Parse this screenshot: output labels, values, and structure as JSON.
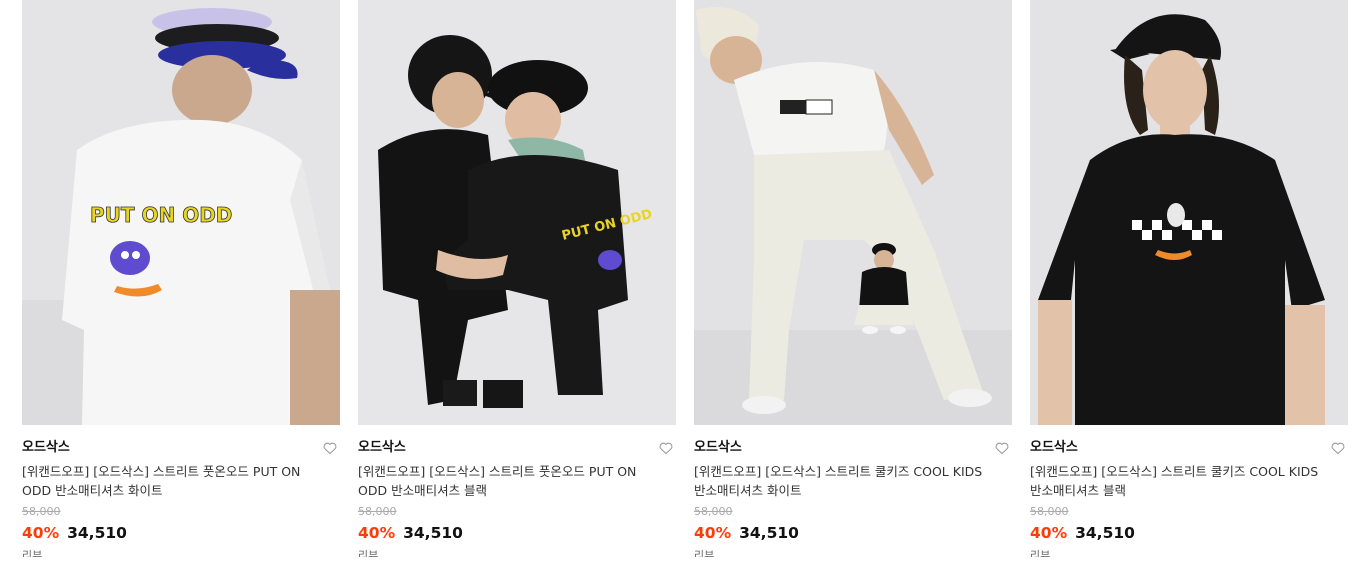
{
  "products": [
    {
      "brand": "오드삭스",
      "title": "[위캔드오프] [오드삭스] 스트리트 풋온오드 PUT ON ODD 반소매티셔츠 화이트",
      "original_price": "58,000",
      "discount": "40%",
      "price": "34,510",
      "photo_graphic_text": "PUT ON ODD",
      "cutoff_text": "리뷰"
    },
    {
      "brand": "오드삭스",
      "title": "[위캔드오프] [오드삭스] 스트리트 풋온오드 PUT ON ODD 반소매티셔츠 블랙",
      "original_price": "58,000",
      "discount": "40%",
      "price": "34,510",
      "photo_graphic_text": "PUT ON ODD",
      "cutoff_text": "리뷰"
    },
    {
      "brand": "오드삭스",
      "title": "[위캔드오프] [오드삭스] 스트리트 쿨키즈 COOL KIDS 반소매티셔츠 화이트",
      "original_price": "58,000",
      "discount": "40%",
      "price": "34,510",
      "cutoff_text": "리뷰"
    },
    {
      "brand": "오드삭스",
      "title": "[위캔드오프] [오드삭스] 스트리트 쿨키즈 COOL KIDS 반소매티셔츠 블랙",
      "original_price": "58,000",
      "discount": "40%",
      "price": "34,510",
      "cutoff_text": "리뷰"
    }
  ],
  "icons": {
    "wishlist": "heart-outline-icon"
  },
  "colors": {
    "discount": "#ff3b0a",
    "text": "#111111",
    "original_price": "#aaaaaa"
  }
}
